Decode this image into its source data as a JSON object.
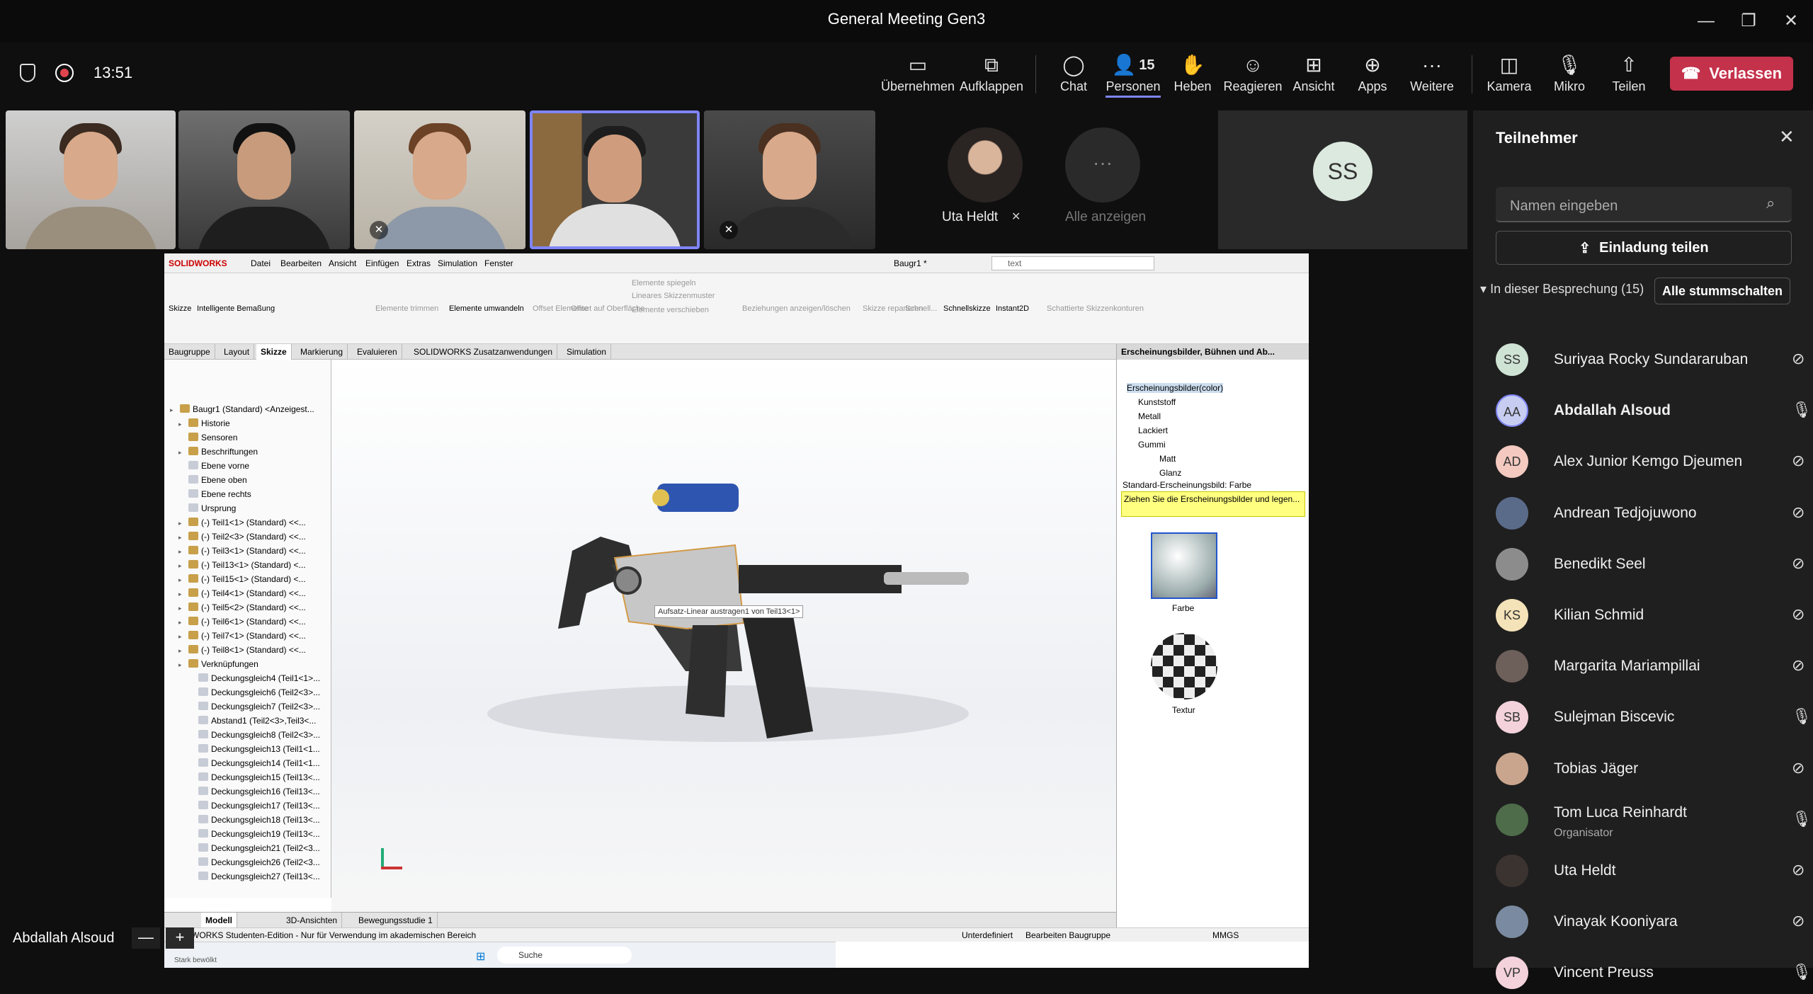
{
  "window": {
    "title": "General Meeting Gen3"
  },
  "meeting": {
    "timer": "13:51",
    "shield_icon": "shield-icon",
    "record_icon": "record-icon"
  },
  "toolbar": {
    "takeover": "Übernehmen",
    "popout": "Aufklappen",
    "chat": "Chat",
    "people": "Personen",
    "people_count": "15",
    "raise": "Heben",
    "react": "Reagieren",
    "view": "Ansicht",
    "apps": "Apps",
    "more": "Weitere",
    "camera": "Kamera",
    "mic": "Mikro",
    "share": "Teilen",
    "leave": "Verlassen"
  },
  "gallery": {
    "uta_name": "Uta Heldt",
    "show_all": "Alle anzeigen",
    "ss_initials": "SS"
  },
  "solidworks": {
    "logo": "SOLIDWORKS",
    "menus": [
      "Datei",
      "Bearbeiten",
      "Ansicht",
      "Einfügen",
      "Extras",
      "Simulation",
      "Fenster"
    ],
    "doc_title": "Baugr1 *",
    "search": "text",
    "ribbon": [
      "Skizze",
      "Intelligente Bemaßung",
      "Elemente trimmen",
      "Elemente umwandeln",
      "Offset Elemente",
      "Offset auf Oberfläche",
      "Elemente spiegeln",
      "Lineares Skizzenmuster",
      "Elemente verschieben",
      "Beziehungen anzeigen/löschen",
      "Skizze reparieren",
      "Schnell...",
      "Schnellskizze",
      "Instant2D",
      "Schattierte Skizzenkonturen"
    ],
    "tabs": [
      "Baugruppe",
      "Layout",
      "Skizze",
      "Markierung",
      "Evaluieren",
      "SOLIDWORKS Zusatzanwendungen",
      "Simulation"
    ],
    "tree": [
      "Baugr1 (Standard) <Anzeigest...",
      "Historie",
      "Sensoren",
      "Beschriftungen",
      "Ebene vorne",
      "Ebene oben",
      "Ebene rechts",
      "Ursprung",
      "(-) Teil1<1> (Standard) <<...",
      "(-) Teil2<3> (Standard) <<...",
      "(-) Teil3<1> (Standard) <<...",
      "(-) Teil13<1> (Standard) <...",
      "(-) Teil15<1> (Standard) <...",
      "(-) Teil4<1> (Standard) <<...",
      "(-) Teil5<2> (Standard) <<...",
      "(-) Teil6<1> (Standard) <<...",
      "(-) Teil7<1> (Standard) <<...",
      "(-) Teil8<1> (Standard) <<...",
      "Verknüpfungen",
      "Deckungsgleich4 (Teil1<1>...",
      "Deckungsgleich6 (Teil2<3>...",
      "Deckungsgleich7 (Teil2<3>...",
      "Abstand1 (Teil2<3>,Teil3<...",
      "Deckungsgleich8 (Teil2<3>...",
      "Deckungsgleich13 (Teil1<1...",
      "Deckungsgleich14 (Teil1<1...",
      "Deckungsgleich15 (Teil13<...",
      "Deckungsgleich16 (Teil13<...",
      "Deckungsgleich17 (Teil13<...",
      "Deckungsgleich18 (Teil13<...",
      "Deckungsgleich19 (Teil13<...",
      "Deckungsgleich21 (Teil2<3...",
      "Deckungsgleich26 (Teil2<3...",
      "Deckungsgleich27 (Teil13<..."
    ],
    "tooltip": "Aufsatz-Linear austragen1 von Teil13<1>",
    "panel_title": "Erscheinungsbilder, Bühnen und Ab...",
    "appearance_tree": [
      "Erscheinungsbilder(color)",
      "Kunststoff",
      "Metall",
      "Lackiert",
      "Gummi",
      "Matt",
      "Glanz"
    ],
    "default_appearance": "Standard-Erscheinungsbild: Farbe",
    "hint": "Ziehen Sie die Erscheinungsbilder und legen...",
    "swatch1": "Farbe",
    "swatch2": "Textur",
    "bottom_tabs": [
      "Modell",
      "3D-Ansichten",
      "Bewegungsstudie 1"
    ],
    "status_left": "SOLIDWORKS Studenten-Edition - Nur für Verwendung im akademischen Bereich",
    "status_mid": "Unterdefiniert",
    "status_edit": "Bearbeiten Baugruppe",
    "status_units": "MMGS",
    "taskbar_search": "Suche",
    "taskbar_note": "Stark bewölkt"
  },
  "panel": {
    "title": "Teilnehmer",
    "search_placeholder": "Namen eingeben",
    "invite": "Einladung teilen",
    "section": "In dieser Besprechung (15)",
    "mute_all": "Alle stummschalten",
    "participants": [
      {
        "initials": "SS",
        "name": "Suriyaa Rocky Sundararuban",
        "role": "",
        "mic": "muted",
        "color": "#cfe3d4"
      },
      {
        "initials": "AA",
        "name": "Abdallah Alsoud",
        "role": "",
        "mic": "on",
        "color": "#c7cdf0"
      },
      {
        "initials": "AD",
        "name": "Alex Junior Kemgo Djeumen",
        "role": "",
        "mic": "muted",
        "color": "#f3c9c0"
      },
      {
        "initials": "",
        "name": "Andrean Tedjojuwono",
        "role": "",
        "mic": "muted",
        "color": "#5a6b8a"
      },
      {
        "initials": "",
        "name": "Benedikt Seel",
        "role": "",
        "mic": "muted",
        "color": "#8c8c8c"
      },
      {
        "initials": "KS",
        "name": "Kilian Schmid",
        "role": "",
        "mic": "muted",
        "color": "#f4e2b8"
      },
      {
        "initials": "",
        "name": "Margarita Mariampillai",
        "role": "",
        "mic": "muted",
        "color": "#6d5f5a"
      },
      {
        "initials": "SB",
        "name": "Sulejman Biscevic",
        "role": "",
        "mic": "on",
        "color": "#f3d2dc"
      },
      {
        "initials": "",
        "name": "Tobias Jäger",
        "role": "",
        "mic": "muted",
        "color": "#c9a58d"
      },
      {
        "initials": "",
        "name": "Tom Luca Reinhardt",
        "role": "Organisator",
        "mic": "on",
        "color": "#4e6b4a"
      },
      {
        "initials": "",
        "name": "Uta Heldt",
        "role": "",
        "mic": "muted",
        "color": "#3b3330"
      },
      {
        "initials": "",
        "name": "Vinayak Kooniyara",
        "role": "",
        "mic": "muted",
        "color": "#7a8aa0"
      },
      {
        "initials": "VP",
        "name": "Vincent Preuss",
        "role": "",
        "mic": "on",
        "color": "#f3d2dc"
      }
    ]
  },
  "self": {
    "name": "Abdallah Alsoud"
  }
}
